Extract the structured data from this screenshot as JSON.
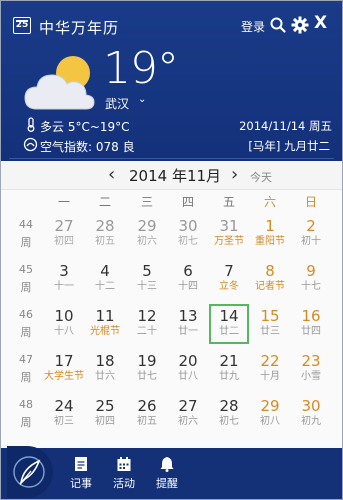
{
  "app": {
    "title": "中华万年历",
    "login_label": "登录",
    "close_label": "X"
  },
  "weather": {
    "temperature": "19°",
    "city": "武汉",
    "condition": "多云 5°C~19°C",
    "aqi": "空气指数: 078 良",
    "date": "2014/11/14 周五",
    "lunar": "[马年] 九月廿二",
    "icon": "partly-cloudy-icon"
  },
  "calendar": {
    "month_title": "2014 年11月",
    "today_label": "今天",
    "weekdays": [
      "一",
      "二",
      "三",
      "四",
      "五",
      "六",
      "日"
    ],
    "week_label": "周",
    "weeks": [
      {
        "num": "44",
        "days": [
          {
            "d": "27",
            "l": "初四",
            "other": true
          },
          {
            "d": "28",
            "l": "初五",
            "other": true
          },
          {
            "d": "29",
            "l": "初六",
            "other": true
          },
          {
            "d": "30",
            "l": "初七",
            "other": true
          },
          {
            "d": "31",
            "l": "万圣节",
            "other": true,
            "fest": true
          },
          {
            "d": "1",
            "l": "重阳节",
            "fest": true
          },
          {
            "d": "2",
            "l": "初十"
          }
        ]
      },
      {
        "num": "45",
        "days": [
          {
            "d": "3",
            "l": "十一"
          },
          {
            "d": "4",
            "l": "十二"
          },
          {
            "d": "5",
            "l": "十三"
          },
          {
            "d": "6",
            "l": "十四"
          },
          {
            "d": "7",
            "l": "立冬",
            "fest": true
          },
          {
            "d": "8",
            "l": "记者节",
            "fest": true
          },
          {
            "d": "9",
            "l": "十七"
          }
        ]
      },
      {
        "num": "46",
        "days": [
          {
            "d": "10",
            "l": "十八"
          },
          {
            "d": "11",
            "l": "光棍节",
            "fest": true
          },
          {
            "d": "12",
            "l": "二十"
          },
          {
            "d": "13",
            "l": "廿一"
          },
          {
            "d": "14",
            "l": "廿二",
            "today": true
          },
          {
            "d": "15",
            "l": "廿三"
          },
          {
            "d": "16",
            "l": "廿四"
          }
        ]
      },
      {
        "num": "47",
        "days": [
          {
            "d": "17",
            "l": "大学生节",
            "fest": true
          },
          {
            "d": "18",
            "l": "廿六"
          },
          {
            "d": "19",
            "l": "廿七"
          },
          {
            "d": "20",
            "l": "廿八"
          },
          {
            "d": "21",
            "l": "廿九"
          },
          {
            "d": "22",
            "l": "十月"
          },
          {
            "d": "23",
            "l": "小雪"
          }
        ]
      },
      {
        "num": "48",
        "days": [
          {
            "d": "24",
            "l": "初三"
          },
          {
            "d": "25",
            "l": "初四"
          },
          {
            "d": "26",
            "l": "初五"
          },
          {
            "d": "27",
            "l": "初六"
          },
          {
            "d": "28",
            "l": "初七"
          },
          {
            "d": "29",
            "l": "初八"
          },
          {
            "d": "30",
            "l": "初九"
          }
        ]
      }
    ]
  },
  "bottombar": {
    "notes_label": "记事",
    "activity_label": "活动",
    "remind_label": "提醒"
  },
  "colors": {
    "header_blue": "#163581",
    "weekend": "#d88a22",
    "today_border": "#55b860"
  }
}
